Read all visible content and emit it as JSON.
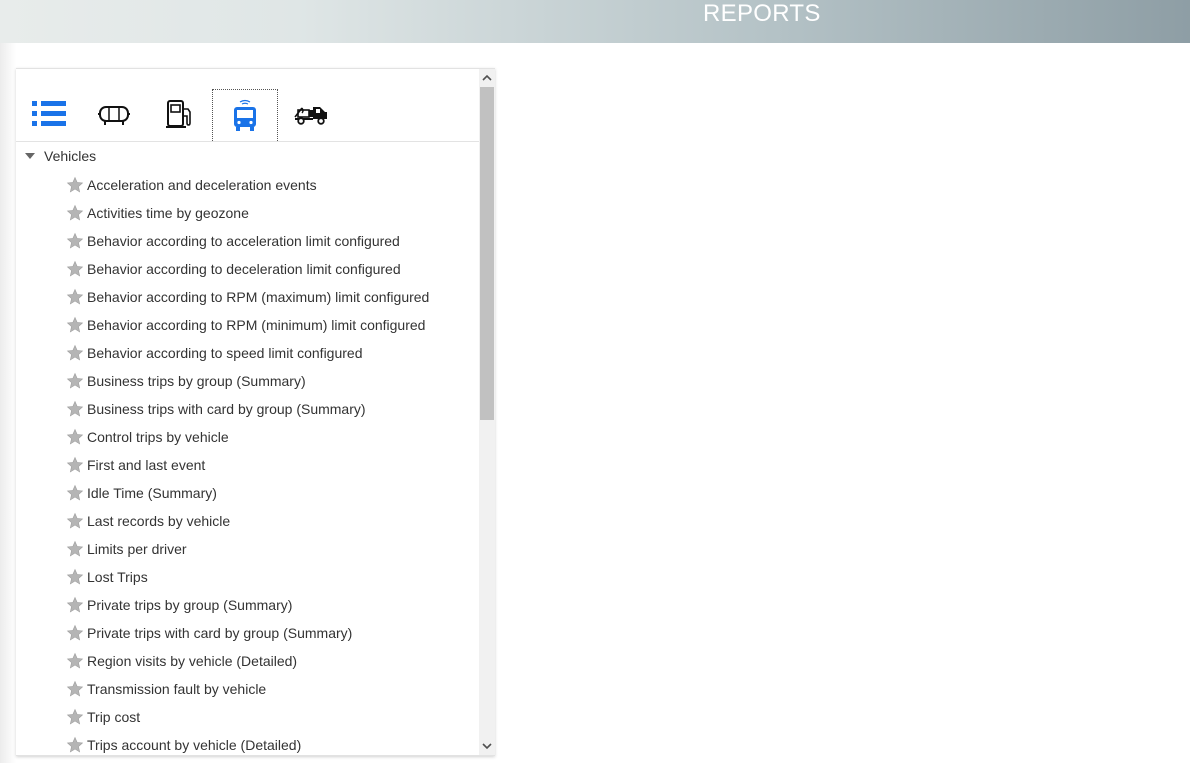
{
  "header": {
    "title": "REPORTS"
  },
  "tabs": [
    {
      "icon": "list-icon",
      "active": false
    },
    {
      "icon": "tank-icon",
      "active": false
    },
    {
      "icon": "fuel-pump-icon",
      "active": false
    },
    {
      "icon": "bus-icon",
      "active": true
    },
    {
      "icon": "tow-truck-icon",
      "active": false
    }
  ],
  "tree": {
    "root_label": "Vehicles",
    "items": [
      {
        "label": "Acceleration and deceleration events"
      },
      {
        "label": "Activities time by geozone"
      },
      {
        "label": "Behavior according to acceleration limit configured"
      },
      {
        "label": "Behavior according to deceleration limit configured"
      },
      {
        "label": "Behavior according to RPM (maximum) limit configured"
      },
      {
        "label": "Behavior according to RPM (minimum) limit configured"
      },
      {
        "label": "Behavior according to speed limit configured"
      },
      {
        "label": "Business trips by group (Summary)"
      },
      {
        "label": "Business trips with card by group (Summary)"
      },
      {
        "label": "Control trips by vehicle"
      },
      {
        "label": "First and last event"
      },
      {
        "label": "Idle Time (Summary)"
      },
      {
        "label": "Last records by vehicle"
      },
      {
        "label": "Limits per driver"
      },
      {
        "label": "Lost Trips"
      },
      {
        "label": "Private trips by group (Summary)"
      },
      {
        "label": "Private trips with card by group (Summary)"
      },
      {
        "label": "Region visits by vehicle (Detailed)"
      },
      {
        "label": "Transmission fault by vehicle"
      },
      {
        "label": "Trip cost"
      },
      {
        "label": "Trips account by vehicle (Detailed)"
      }
    ]
  },
  "colors": {
    "accent": "#1a73e8",
    "header_gradient_end": "#8e9ea5"
  }
}
